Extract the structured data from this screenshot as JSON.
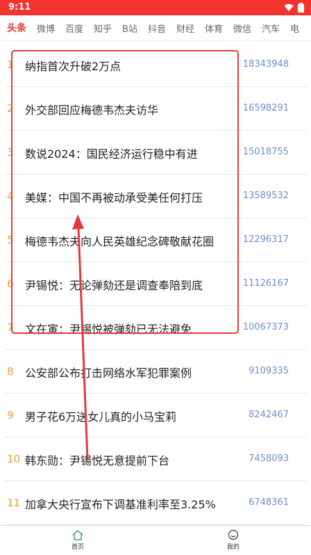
{
  "status": {
    "time": "9:11"
  },
  "tabs": [
    "头条",
    "微博",
    "百度",
    "知乎",
    "B站",
    "抖音",
    "财经",
    "体育",
    "微信",
    "汽车",
    "电"
  ],
  "items": [
    {
      "rank": "1",
      "title": "纳指首次升破2万点",
      "count": "18343948"
    },
    {
      "rank": "2",
      "title": "外交部回应梅德韦杰夫访华",
      "count": "16598291"
    },
    {
      "rank": "3",
      "title": "数说2024：国民经济运行稳中有进",
      "count": "15018755"
    },
    {
      "rank": "4",
      "title": "美媒：中国不再被动承受美任何打压",
      "count": "13589532"
    },
    {
      "rank": "5",
      "title": "梅德韦杰夫向人民英雄纪念碑敬献花圈",
      "count": "12296317"
    },
    {
      "rank": "6",
      "title": "尹锡悦：无论弹劾还是调查奉陪到底",
      "count": "11126167"
    },
    {
      "rank": "7",
      "title": "文在寅：尹锡悦被弹劾已无法避免",
      "count": "10067373"
    },
    {
      "rank": "8",
      "title": "公安部公布打击网络水军犯罪案例",
      "count": "9109335"
    },
    {
      "rank": "9",
      "title": "男子花6万送女儿真的小马宝莉",
      "count": "8242467"
    },
    {
      "rank": "10",
      "title": "韩东勋：尹锡悦无意提前下台",
      "count": "7458093"
    },
    {
      "rank": "11",
      "title": "加拿大央行宣布下调基准利率至3.25%",
      "count": "6748361"
    }
  ],
  "bottom_nav": {
    "home": "首页",
    "mine": "我的"
  },
  "colors": {
    "accent": "#e8342f",
    "statusbar": "#f4322e",
    "rank": "#f29b3c",
    "count": "#6a8fd0",
    "highlight": "#e23a3a"
  }
}
